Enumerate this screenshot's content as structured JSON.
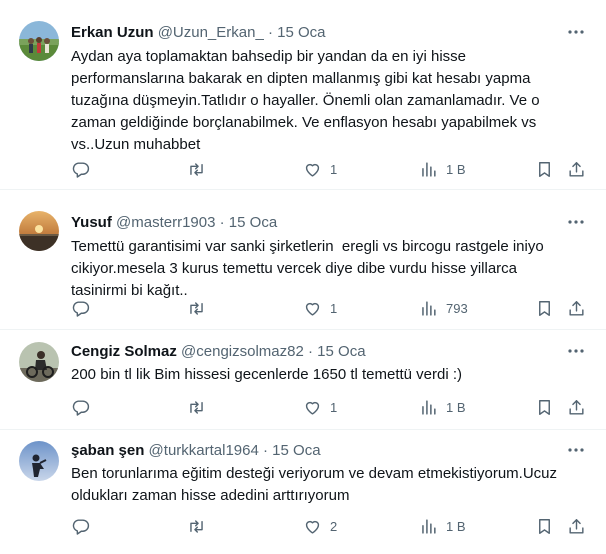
{
  "tweets": [
    {
      "name": "Erkan Uzun",
      "handle": "@Uzun_Erkan_",
      "separator": "·",
      "date": "15 Oca",
      "text": "Aydan aya toplamaktan bahsedip bir yandan da en iyi hisse\nperformanslarına bakarak en dipten mallanmış gibi kat hesabı yapma\ntuzağına düşmeyin.Tatlıdır o hayaller. Önemli olan zamanlamadır. Ve o\nzaman geldiğinde borçlanabilmek. Ve enflasyon hesabı yapabilmek vs\nvs..Uzun muhabbet",
      "likes": "1",
      "views": "1 B",
      "avatar": "people-outdoors"
    },
    {
      "name": "Yusuf",
      "handle": "@masterr1903",
      "separator": "·",
      "date": "15 Oca",
      "text": "Temettü garantisimi var sanki şirketlerin  eregli vs bircogu rastgele iniyo\ncikiyor.mesela 3 kurus temettu vercek diye dibe vurdu hisse yillarca\ntasinirmi bi kağıt..",
      "likes": "1",
      "views": "793",
      "avatar": "sunset"
    },
    {
      "name": "Cengiz Solmaz",
      "handle": "@cengizsolmaz82",
      "separator": "·",
      "date": "15 Oca",
      "text": "200 bin tl lik Bim hissesi gecenlerde 1650 tl temettü verdi :)",
      "likes": "1",
      "views": "1 B",
      "avatar": "rider"
    },
    {
      "name": "şaban şen",
      "handle": "@turkkartal1964",
      "separator": "·",
      "date": "15 Oca",
      "text": "Ben torunlarıma eğitim desteği veriyorum ve devam etmekistiyorum.Ucuz\noldukları zaman hisse adedini arttırıyorum",
      "likes": "2",
      "views": "1 B",
      "avatar": "silhouette-sky"
    }
  ],
  "icons": {
    "reply": "reply-icon",
    "retweet": "retweet-icon",
    "like": "heart-icon",
    "views": "views-chart-icon",
    "bookmark": "bookmark-icon",
    "share": "share-icon",
    "more": "more-icon"
  },
  "colors": {
    "text": "#0f1419",
    "secondary": "#536471",
    "divider": "#eff3f4"
  }
}
